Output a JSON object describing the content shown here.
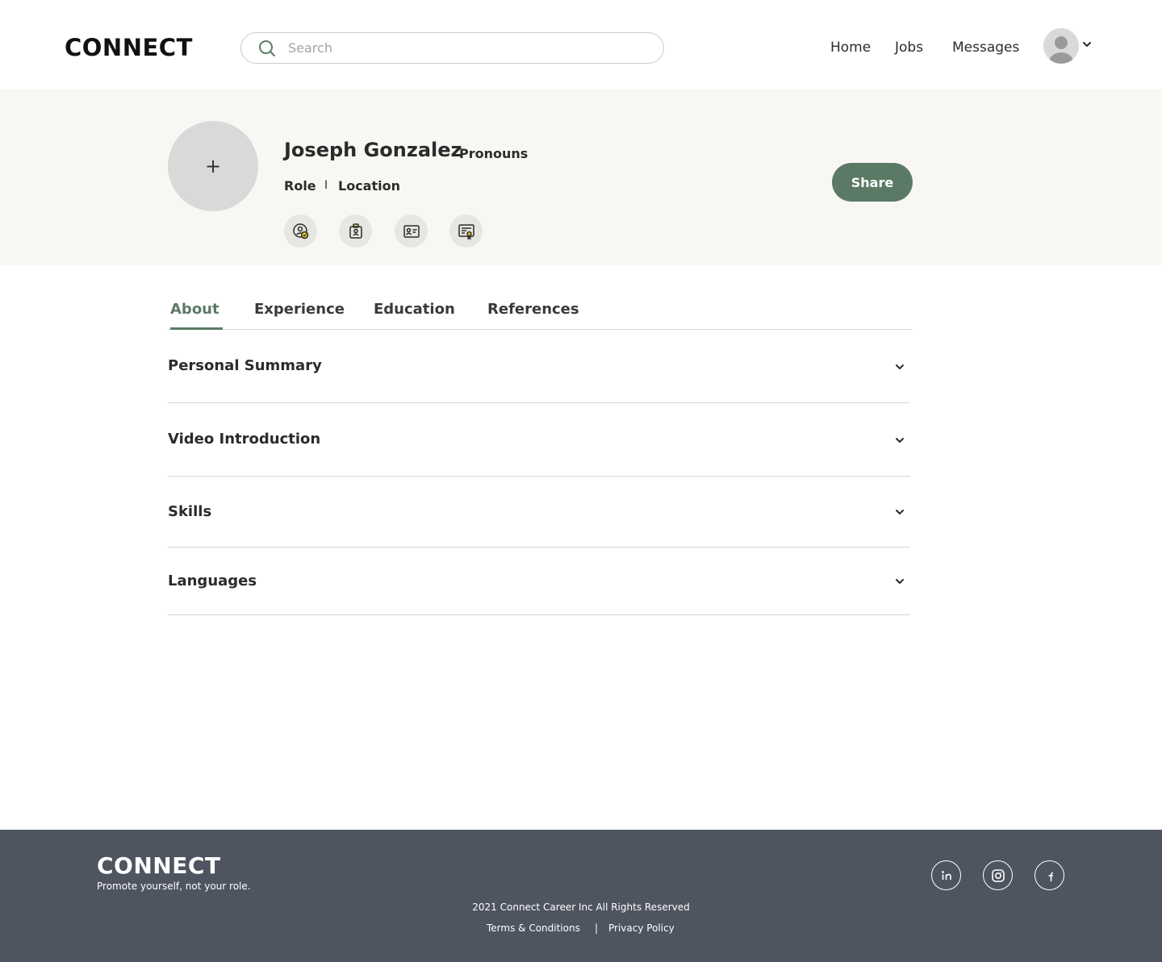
{
  "header": {
    "logo": "CONNECT",
    "search_placeholder": "Search",
    "nav": [
      {
        "label": "Home"
      },
      {
        "label": "Jobs"
      },
      {
        "label": "Messages"
      }
    ]
  },
  "profile": {
    "photo_add": "+",
    "name": "Joseph Gonzalez",
    "pronouns": "Pronouns",
    "role": "Role",
    "separator": "I",
    "location": "Location",
    "share_label": "Share",
    "badges": [
      "verified-user-icon",
      "id-badge-icon",
      "id-card-icon",
      "certificate-icon"
    ]
  },
  "tabs": [
    {
      "label": "About",
      "active": true
    },
    {
      "label": "Experience"
    },
    {
      "label": "Education"
    },
    {
      "label": "References"
    }
  ],
  "sections": [
    {
      "title": "Personal Summary"
    },
    {
      "title": "Video Introduction"
    },
    {
      "title": "Skills"
    },
    {
      "title": "Languages"
    }
  ],
  "footer": {
    "logo": "CONNECT",
    "tagline": "Promote yourself, not your role.",
    "copyright": "2021 Connect Career Inc All Rights Reserved",
    "terms": "Terms & Conditions",
    "separator": "|",
    "privacy": "Privacy Policy",
    "social": [
      "linkedin-icon",
      "instagram-icon",
      "facebook-icon"
    ]
  },
  "colors": {
    "accent": "#5b7a66",
    "band": "#f8f7f3",
    "footer": "#4e5460",
    "badge_dot": "#e7c22b"
  }
}
